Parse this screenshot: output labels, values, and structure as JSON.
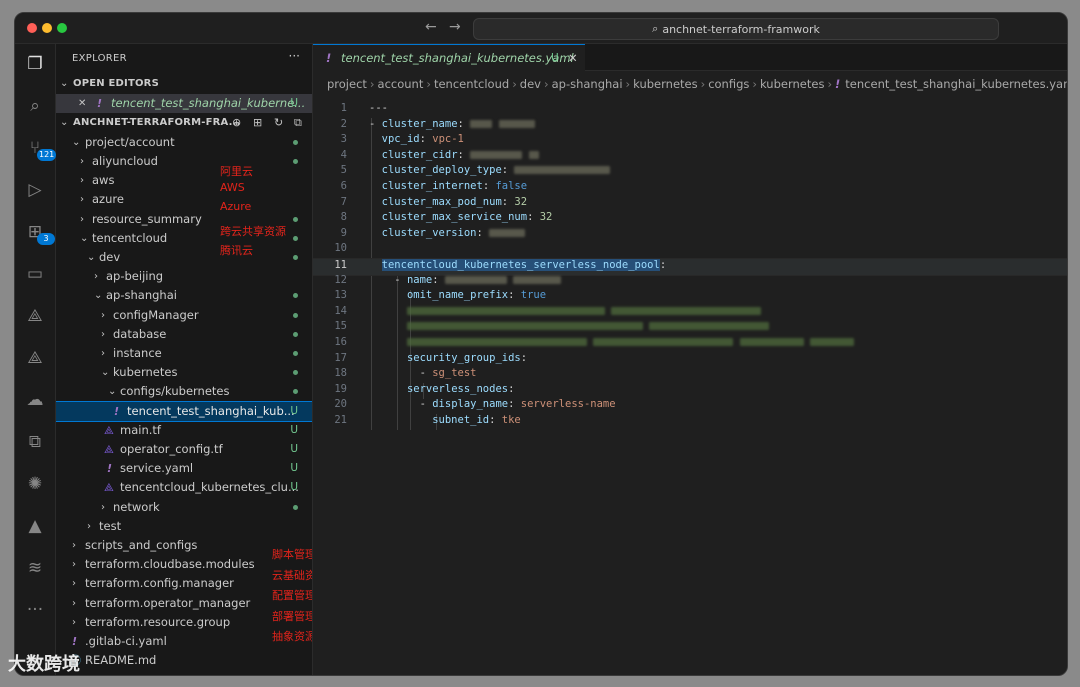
{
  "window": {
    "command_center": "anchnet-terraform-framwork"
  },
  "sidebar": {
    "title": "EXPLORER",
    "more": "···",
    "open_editors_label": "OPEN EDITORS",
    "open_editor_file": "tencent_test_shanghai_kuberne...",
    "open_editor_status": "U",
    "project_label": "ANCHNET-TERRAFORM-FRA...",
    "tree": [
      {
        "label": "project/account",
        "annot": ""
      },
      {
        "label": "aliyuncloud",
        "annot": "阿里云"
      },
      {
        "label": "aws",
        "annot": "AWS"
      },
      {
        "label": "azure",
        "annot": "Azure"
      },
      {
        "label": "resource_summary",
        "annot": "跨云共享资源"
      },
      {
        "label": "tencentcloud",
        "annot": "腾讯云"
      },
      {
        "label": "dev",
        "annot": ""
      },
      {
        "label": "ap-beijing",
        "annot": ""
      },
      {
        "label": "ap-shanghai",
        "annot": ""
      },
      {
        "label": "configManager",
        "annot": ""
      },
      {
        "label": "database",
        "annot": ""
      },
      {
        "label": "instance",
        "annot": ""
      },
      {
        "label": "kubernetes",
        "annot": ""
      },
      {
        "label": "configs/kubernetes",
        "annot": ""
      },
      {
        "label": "tencent_test_shanghai_kub...",
        "annot": "",
        "status": "U"
      },
      {
        "label": "main.tf",
        "annot": "",
        "status": "U"
      },
      {
        "label": "operator_config.tf",
        "annot": "",
        "status": "U"
      },
      {
        "label": "service.yaml",
        "annot": "",
        "status": "U"
      },
      {
        "label": "tencentcloud_kubernetes_clu...",
        "annot": "",
        "status": "U"
      },
      {
        "label": "network",
        "annot": ""
      },
      {
        "label": "test",
        "annot": ""
      },
      {
        "label": "scripts_and_configs",
        "annot": "脚本管理"
      },
      {
        "label": "terraform.cloudbase.modules",
        "annot": "云基础资源管理"
      },
      {
        "label": "terraform.config.manager",
        "annot": "配置管理"
      },
      {
        "label": "terraform.operator_manager",
        "annot": "部署管理"
      },
      {
        "label": "terraform.resource.group",
        "annot": "抽象资源组"
      },
      {
        "label": ".gitlab-ci.yaml",
        "annot": ""
      },
      {
        "label": "README.md",
        "annot": ""
      }
    ],
    "activity_badges": {
      "scm": "121",
      "extensions": "3"
    }
  },
  "editor": {
    "tab": {
      "label": "tencent_test_shanghai_kubernetes.yaml",
      "status": "U",
      "close": "✕"
    },
    "breadcrumbs": [
      "project",
      "account",
      "tencentcloud",
      "dev",
      "ap-shanghai",
      "kubernetes",
      "configs",
      "kubernetes",
      "tencent_test_shanghai_kubernetes.yaml"
    ],
    "lines": {
      "l1": "---",
      "l2_key": "cluster_name",
      "l3_key": "vpc_id",
      "l3_val": "vpc-1",
      "l4_key": "cluster_cidr",
      "l5_key": "cluster_deploy_type",
      "l6_key": "cluster_internet",
      "l6_val": "false",
      "l7_key": "cluster_max_pod_num",
      "l7_val": "32",
      "l8_key": "cluster_max_service_num",
      "l8_val": "32",
      "l9_key": "cluster_version",
      "l11_key": "tencentcloud_kubernetes_serverless_node_pool",
      "l12_key": "name",
      "l13_key": "omit_name_prefix",
      "l13_val": "true",
      "l17_key": "security_group_ids",
      "l18_val": "sg_test",
      "l19_key": "serverless_nodes",
      "l20_key": "display_name",
      "l20_val": "serverless-name",
      "l21_key": "subnet_id",
      "l21_val": "tke"
    },
    "current_line": "11"
  },
  "watermark": "大数跨境"
}
